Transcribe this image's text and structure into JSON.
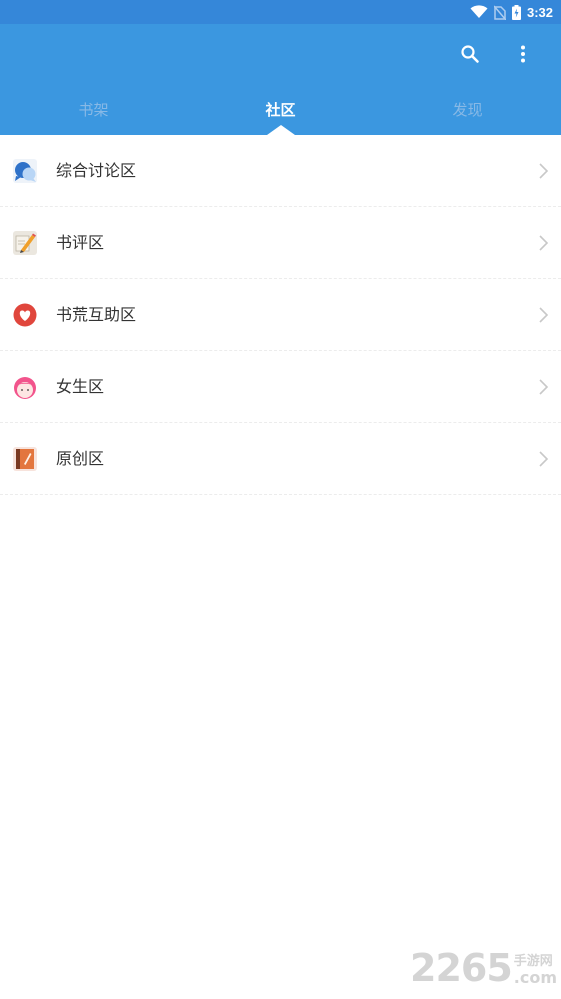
{
  "status_bar": {
    "time": "3:32",
    "icons": [
      "wifi-icon",
      "no-sim-icon",
      "battery-charging-icon"
    ]
  },
  "toolbar": {
    "icons": [
      "search-icon",
      "more-vert-icon"
    ]
  },
  "tabs": [
    {
      "label": "书架",
      "active": false
    },
    {
      "label": "社区",
      "active": true
    },
    {
      "label": "发现",
      "active": false
    }
  ],
  "community_list": [
    {
      "label": "综合讨论区",
      "icon": "discussion-bubbles-icon"
    },
    {
      "label": "书评区",
      "icon": "review-pencil-icon"
    },
    {
      "label": "书荒互助区",
      "icon": "heart-help-icon"
    },
    {
      "label": "女生区",
      "icon": "girl-face-icon"
    },
    {
      "label": "原创区",
      "icon": "original-book-icon"
    }
  ],
  "watermark": {
    "number": "2265",
    "site_cn": "手游网",
    "site_com": ".com"
  },
  "colors": {
    "status_bar": "#3587d9",
    "app_bar": "#3b97e0",
    "tab_inactive": "#88b9e6",
    "tab_active": "#ffffff"
  }
}
